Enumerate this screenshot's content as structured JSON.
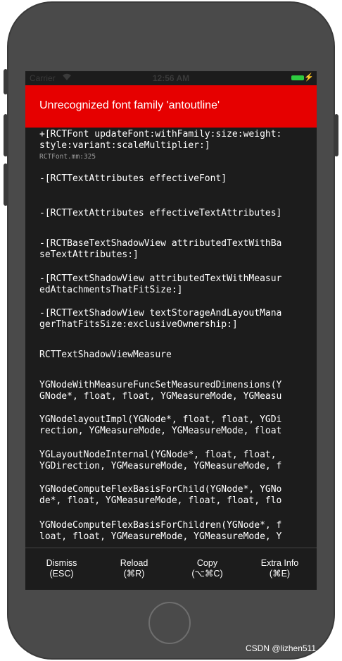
{
  "status_bar": {
    "carrier": "Carrier",
    "wifi_icon": "wifi-icon",
    "time": "12:56 AM",
    "battery_color": "#2ecc40"
  },
  "error": {
    "title": "Unrecognized font family 'antoutline'",
    "background": "#e60000"
  },
  "stack": [
    {
      "line1": "+[RCTFont updateFont:withFamily:size:weight:",
      "line2": "style:variant:scaleMultiplier:]",
      "file": "RCTFont.mm:325"
    },
    {
      "line1": "-[RCTTextAttributes effectiveFont]",
      "line2": ""
    },
    {
      "line1": "-[RCTTextAttributes effectiveTextAttributes]",
      "line2": ""
    },
    {
      "line1": "-[RCTBaseTextShadowView attributedTextWithBa",
      "line2": "seTextAttributes:]"
    },
    {
      "line1": "-[RCTTextShadowView attributedTextWithMeasur",
      "line2": "edAttachmentsThatFitSize:]"
    },
    {
      "line1": "-[RCTTextShadowView textStorageAndLayoutMana",
      "line2": "gerThatFitsSize:exclusiveOwnership:]"
    },
    {
      "line1": "RCTTextShadowViewMeasure",
      "line2": ""
    },
    {
      "line1": "YGNodeWithMeasureFuncSetMeasuredDimensions(Y",
      "line2": "GNode*, float, float, YGMeasureMode, YGMeasu"
    },
    {
      "line1": "YGNodelayoutImpl(YGNode*, float, float, YGDi",
      "line2": "rection, YGMeasureMode, YGMeasureMode, float"
    },
    {
      "line1": "YGLayoutNodeInternal(YGNode*, float, float,",
      "line2": "YGDirection, YGMeasureMode, YGMeasureMode, f"
    },
    {
      "line1": "YGNodeComputeFlexBasisForChild(YGNode*, YGNo",
      "line2": "de*, float, YGMeasureMode, float, float, flo"
    },
    {
      "line1": "YGNodeComputeFlexBasisForChildren(YGNode*, f",
      "line2": "loat, float, YGMeasureMode, YGMeasureMode, Y"
    }
  ],
  "footer": {
    "dismiss": {
      "label": "Dismiss",
      "shortcut": "(ESC)"
    },
    "reload": {
      "label": "Reload",
      "shortcut": "(⌘R)"
    },
    "copy": {
      "label": "Copy",
      "shortcut": "(⌥⌘C)"
    },
    "extra": {
      "label": "Extra Info",
      "shortcut": "(⌘E)"
    }
  },
  "watermark": "CSDN @lizhen511"
}
